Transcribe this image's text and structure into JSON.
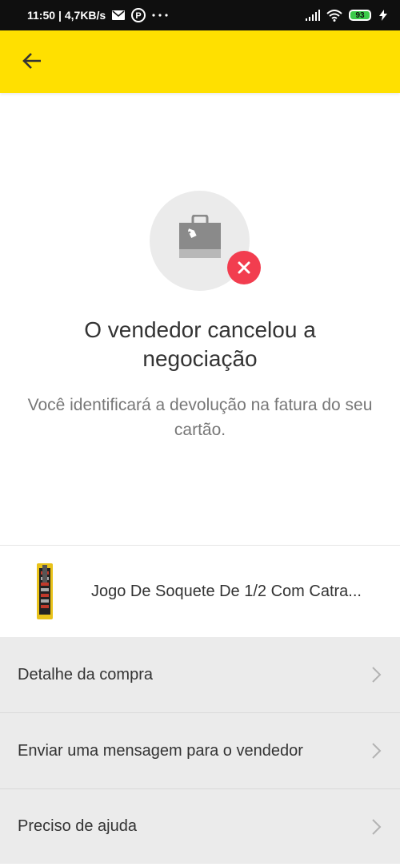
{
  "status_bar": {
    "time": "11:50",
    "net_speed": "| 4,7KB/s",
    "battery": "93",
    "icons": [
      "mail-icon",
      "app-icon",
      "more-dots-icon",
      "signal-icon",
      "wifi-icon",
      "battery-icon",
      "charging-icon"
    ]
  },
  "app_bar": {
    "background": "#ffe000",
    "back_icon": "arrow-left-icon"
  },
  "hero": {
    "icon": "shopping-bag-icon",
    "badge_icon": "close-icon",
    "badge_color": "#f23d4f",
    "title": "O vendedor cancelou a negociação",
    "subtitle": "Você identificará a devolução na fatura do seu cartão."
  },
  "product": {
    "title": "Jogo De Soquete De 1/2 Com Catra...",
    "thumbnail_icon": "socket-set-icon"
  },
  "menu": {
    "items": [
      {
        "label": "Detalhe da compra"
      },
      {
        "label": "Enviar uma mensagem para o vendedor"
      },
      {
        "label": "Preciso de ajuda"
      }
    ]
  }
}
